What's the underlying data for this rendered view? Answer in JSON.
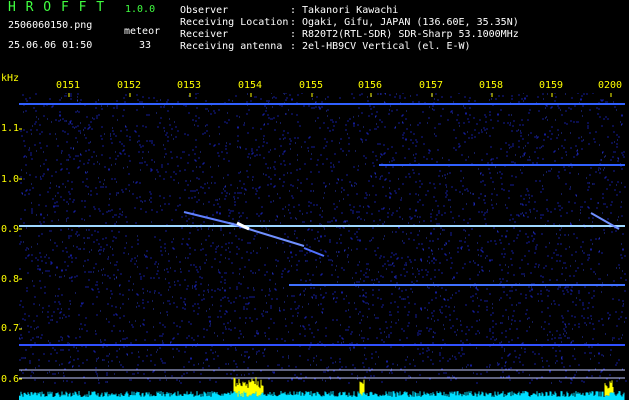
{
  "header": {
    "app_title": "H R O F F T",
    "version": "1.0.0",
    "filename": "2506060150.png",
    "meteor_label": "meteor",
    "timestamp": "25.06.06 01:50",
    "meteor_count": "33"
  },
  "info": [
    {
      "label": "Observer",
      "value": "Takanori Kawachi"
    },
    {
      "label": "Receiving Location",
      "value": "Ogaki, Gifu, JAPAN (136.60E, 35.35N)"
    },
    {
      "label": "Receiver",
      "value": "R820T2(RTL-SDR) SDR-Sharp 53.1000MHz"
    },
    {
      "label": "Receiving antenna",
      "value": "2el-HB9CV Vertical (el. E-W)"
    }
  ],
  "axes": {
    "freq_unit": "kHz",
    "time_ticks": [
      "0151",
      "0152",
      "0153",
      "0154",
      "0155",
      "0156",
      "0157",
      "0158",
      "0159",
      "0200"
    ],
    "freq_ticks": [
      "1.1",
      "1.0",
      "0.9",
      "0.8",
      "0.7",
      "0.6"
    ]
  },
  "colors": {
    "background": "#000000",
    "noise": "#1a24c0",
    "carrier": "#9fd8ff",
    "bar_low": "#00e0ff",
    "bar_high": "#ffff00",
    "label_yellow": "#ffff00",
    "title_green": "#40ff40"
  }
}
